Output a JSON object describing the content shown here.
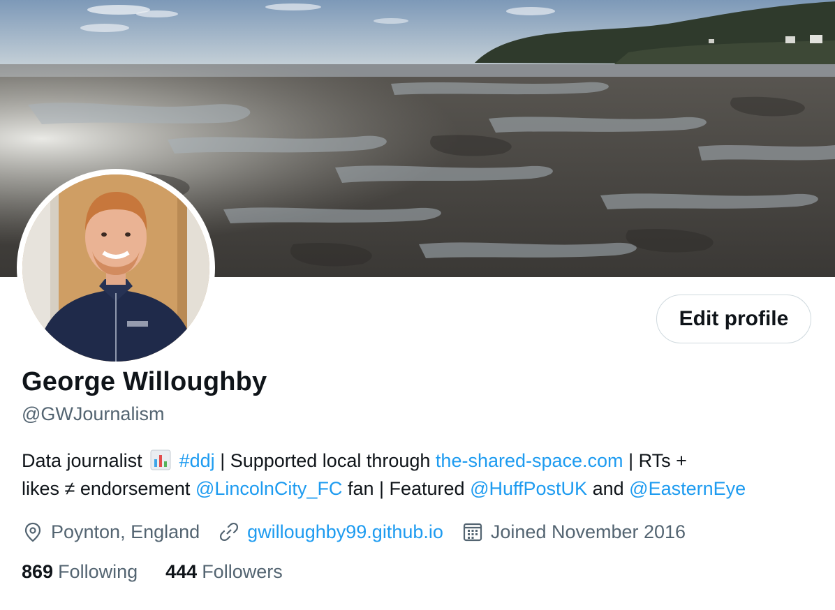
{
  "profile": {
    "name": "George Willoughby",
    "handle": "@GWJournalism",
    "edit_label": "Edit profile",
    "bio": {
      "t1": "Data journalist",
      "hashtag": "#ddj",
      "t2": "| Supported local through",
      "site": "the-shared-space.com",
      "t3": "| RTs +",
      "t4": "likes ≠ endorsement",
      "mention1": "@LincolnCity_FC",
      "t5": "fan | Featured",
      "mention2": "@HuffPostUK",
      "t6": "and",
      "mention3": "@EasternEye"
    },
    "location": "Poynton, England",
    "website": "gwilloughby99.github.io",
    "joined": "Joined November 2016",
    "following_count": "869",
    "following_label": "Following",
    "followers_count": "444",
    "followers_label": "Followers"
  },
  "icons": {
    "location": "location-pin-icon",
    "link": "link-icon",
    "calendar": "calendar-icon",
    "bio_emoji": "bar-chart-emoji-icon"
  },
  "colors": {
    "link": "#1d9bf0",
    "secondary_text": "#536471",
    "primary_text": "#0f1419",
    "button_border": "#cfd9de"
  }
}
